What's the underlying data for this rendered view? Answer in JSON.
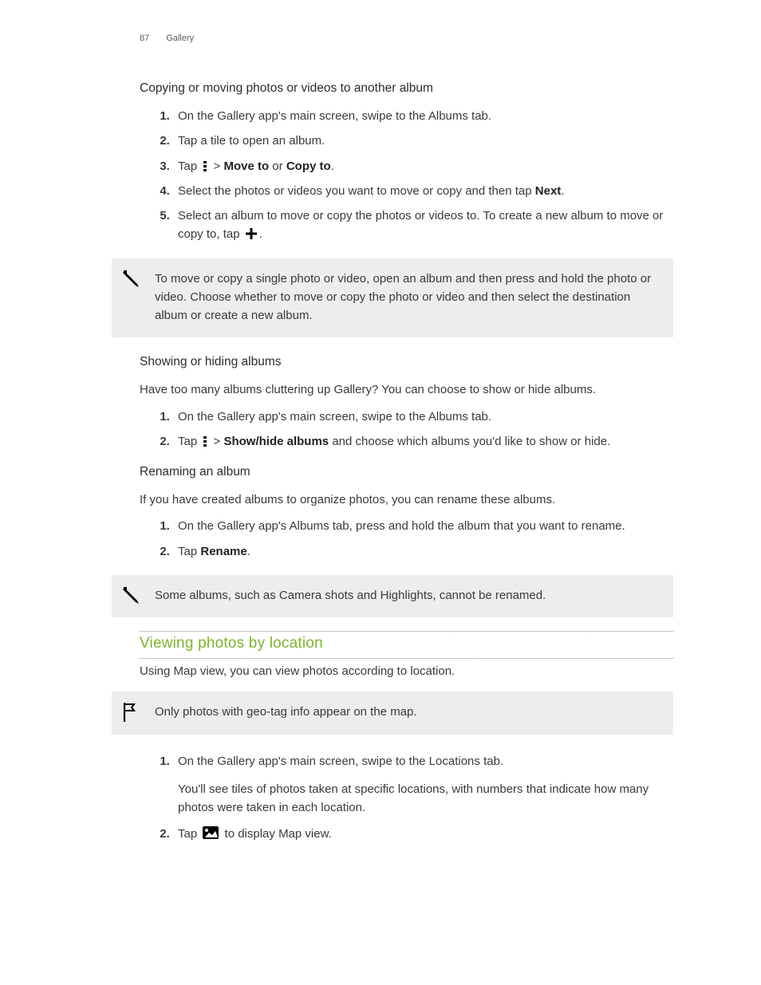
{
  "header": {
    "page_number": "87",
    "section": "Gallery"
  },
  "sec_copy": {
    "title": "Copying or moving photos or videos to another album",
    "steps": {
      "s1": "On the Gallery app's main screen, swipe to the Albums tab.",
      "s2": "Tap a tile to open an album.",
      "s3_a": "Tap ",
      "s3_b": " > ",
      "s3_move": "Move to",
      "s3_or": " or ",
      "s3_copy": "Copy to",
      "s3_c": ".",
      "s4_a": "Select the photos or videos you want to move or copy and then tap ",
      "s4_next": "Next",
      "s4_b": ".",
      "s5_a": "Select an album to move or copy the photos or videos to. To create a new album to move or copy to, tap ",
      "s5_b": "."
    },
    "note": "To move or copy a single photo or video, open an album and then press and hold the photo or video. Choose whether to move or copy the photo or video and then select the destination album or create a new album."
  },
  "sec_showhide": {
    "title": "Showing or hiding albums",
    "intro": "Have too many albums cluttering up Gallery? You can choose to show or hide albums.",
    "steps": {
      "s1": "On the Gallery app's main screen, swipe to the Albums tab.",
      "s2_a": "Tap ",
      "s2_b": " > ",
      "s2_cmd": "Show/hide albums",
      "s2_c": " and choose which albums you'd like to show or hide."
    }
  },
  "sec_rename": {
    "title": "Renaming an album",
    "intro": "If you have created albums to organize photos, you can rename these albums.",
    "steps": {
      "s1": "On the Gallery app's Albums tab, press and hold the album that you want to rename.",
      "s2_a": "Tap ",
      "s2_cmd": "Rename",
      "s2_b": "."
    },
    "note": "Some albums, such as Camera shots and Highlights, cannot be renamed."
  },
  "sec_location": {
    "title": "Viewing photos by location",
    "intro": "Using Map view, you can view photos according to location.",
    "note": "Only photos with geo-tag info appear on the map.",
    "steps": {
      "s1": "On the Gallery app's main screen, swipe to the Locations tab.",
      "s1_body": "You'll see tiles of photos taken at specific locations, with numbers that indicate how many photos were taken in each location.",
      "s2_a": "Tap ",
      "s2_b": " to display Map view."
    }
  }
}
